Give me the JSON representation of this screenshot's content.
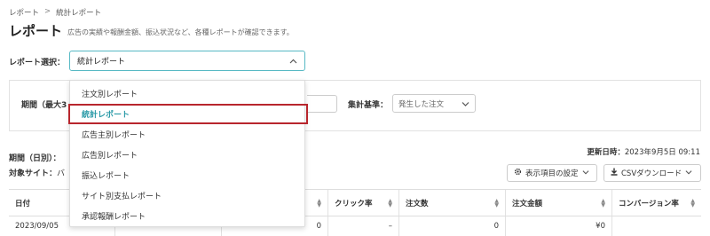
{
  "breadcrumb": {
    "items": [
      "レポート",
      "統計レポート"
    ],
    "separator": ">"
  },
  "header": {
    "title": "レポート",
    "description": "広告の実績や報酬金額、振込状況など、各種レポートが確認できます。"
  },
  "report_select": {
    "label": "レポート選択：",
    "value": "統計レポート",
    "options": [
      "注文別レポート",
      "統計レポート",
      "広告主別レポート",
      "広告別レポート",
      "振込レポート",
      "サイト別支払レポート",
      "承認報酬レポート"
    ],
    "selected_index": 1
  },
  "filters": {
    "period_label": "期間（最大3",
    "basis_label": "集計基準：",
    "basis_value": "発生した注文"
  },
  "summary": {
    "period_day": "期間（日別）：",
    "updated_label": "更新日時：",
    "updated_value": "2023年9月5日 09:11",
    "target_site_label": "対象サイト：",
    "target_site_value": "バ"
  },
  "toolbar": {
    "columns_label": "表示項目の設定",
    "csv_label": "CSVダウンロード"
  },
  "table": {
    "headers": [
      "日付",
      "",
      "",
      "クリック率",
      "注文数",
      "注文金額",
      "コンバージョン率"
    ],
    "rows": [
      [
        "2023/09/05",
        "",
        "0",
        "–",
        "0",
        "¥0",
        ""
      ]
    ]
  },
  "colors": {
    "accent": "#2a9aa7",
    "highlight_border": "#b8262d",
    "select_border": "#57b9c4"
  }
}
